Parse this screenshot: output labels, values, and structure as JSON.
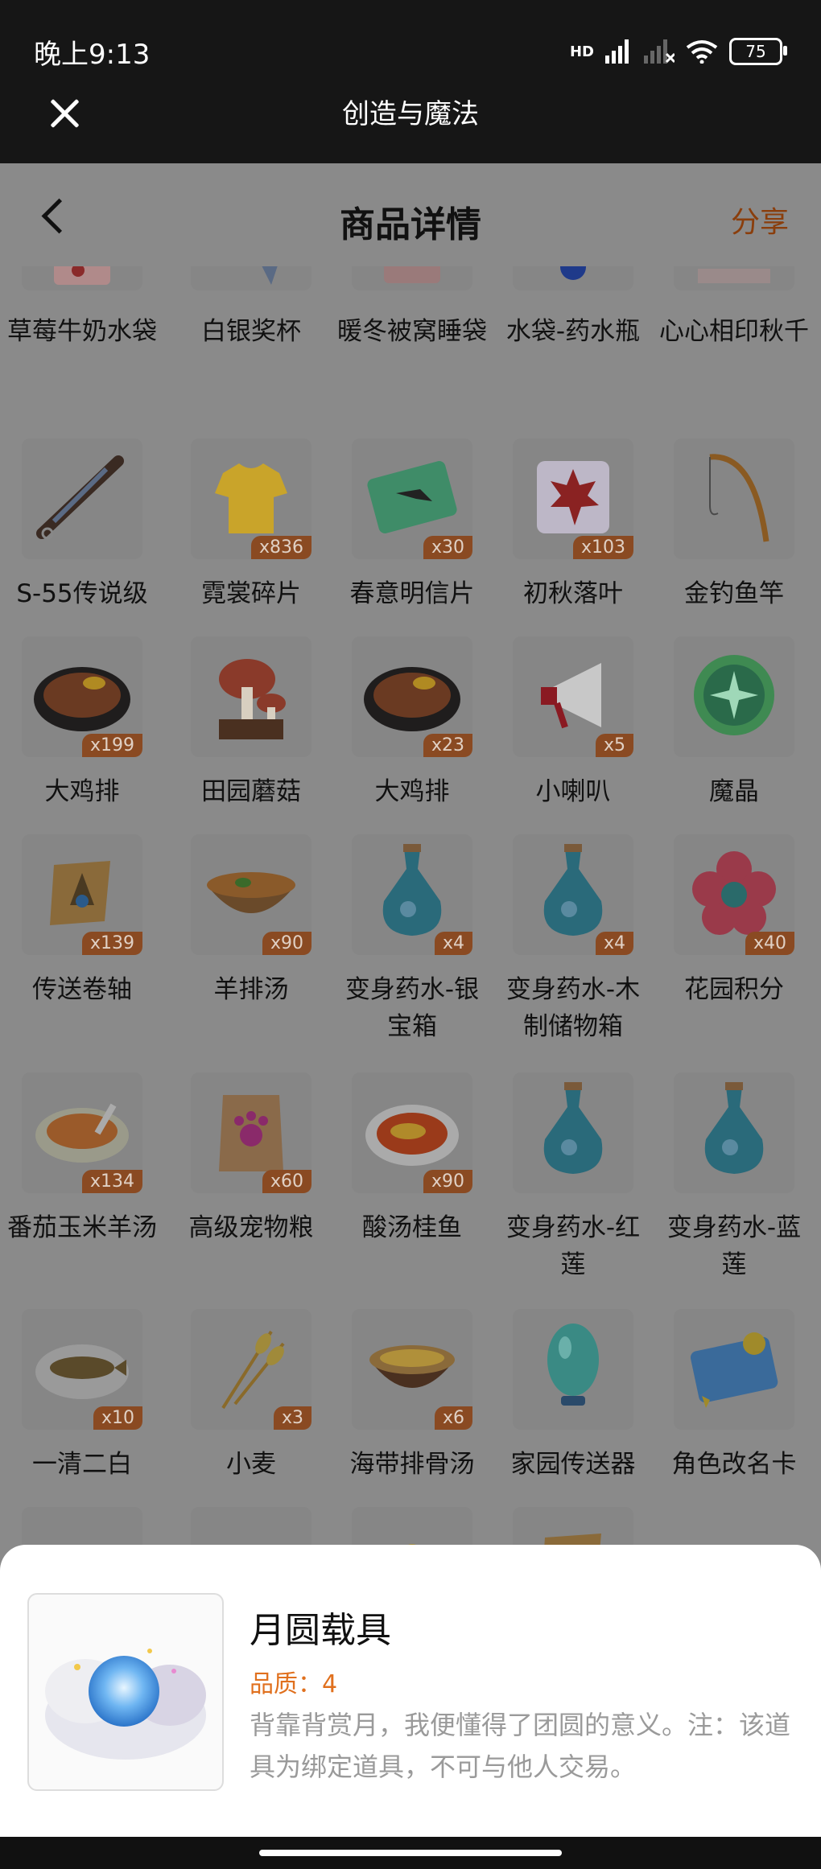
{
  "status_bar": {
    "time": "晚上9:13",
    "network": "HD",
    "battery": "75"
  },
  "app_bar": {
    "title": "创造与魔法"
  },
  "page": {
    "title": "商品详情",
    "share_label": "分享"
  },
  "items_partial_top": [
    {
      "name": "草莓牛奶水袋",
      "icon": "strawberry-milk-bag-icon"
    },
    {
      "name": "白银奖杯",
      "icon": "silver-trophy-icon"
    },
    {
      "name": "暖冬被窝睡袋",
      "icon": "sleeping-bag-icon"
    },
    {
      "name": "水袋-药水瓶",
      "icon": "potion-bottle-icon"
    },
    {
      "name": "心心相印秋千",
      "icon": "swing-icon"
    }
  ],
  "items": [
    {
      "name": "S-55传说级",
      "badge": "",
      "icon": "rifle-icon"
    },
    {
      "name": "霓裳碎片",
      "badge": "x836",
      "icon": "shirt-icon"
    },
    {
      "name": "春意明信片",
      "badge": "x30",
      "icon": "postcard-icon"
    },
    {
      "name": "初秋落叶",
      "badge": "x103",
      "icon": "maple-leaf-icon"
    },
    {
      "name": "金钓鱼竿",
      "badge": "",
      "icon": "fishing-rod-icon"
    },
    {
      "name": "大鸡排",
      "badge": "x199",
      "icon": "chicken-cutlet-icon"
    },
    {
      "name": "田园蘑菇",
      "badge": "",
      "icon": "mushroom-icon"
    },
    {
      "name": "大鸡排",
      "badge": "x23",
      "icon": "chicken-cutlet-icon"
    },
    {
      "name": "小喇叭",
      "badge": "x5",
      "icon": "megaphone-icon"
    },
    {
      "name": "魔晶",
      "badge": "",
      "icon": "magic-crystal-icon"
    },
    {
      "name": "传送卷轴",
      "badge": "x139",
      "icon": "scroll-icon"
    },
    {
      "name": "羊排汤",
      "badge": "x90",
      "icon": "soup-bowl-icon"
    },
    {
      "name": "变身药水-银宝箱",
      "badge": "x4",
      "icon": "potion-icon"
    },
    {
      "name": "变身药水-木制储物箱",
      "badge": "x4",
      "icon": "potion-icon"
    },
    {
      "name": "花园积分",
      "badge": "x40",
      "icon": "flower-icon"
    },
    {
      "name": "番茄玉米羊汤",
      "badge": "x134",
      "icon": "soup-plate-icon"
    },
    {
      "name": "高级宠物粮",
      "badge": "x60",
      "icon": "pet-food-bag-icon"
    },
    {
      "name": "酸汤桂鱼",
      "badge": "x90",
      "icon": "fish-dish-icon"
    },
    {
      "name": "变身药水-红莲",
      "badge": "",
      "icon": "potion-icon"
    },
    {
      "name": "变身药水-蓝莲",
      "badge": "",
      "icon": "potion-icon"
    },
    {
      "name": "一清二白",
      "badge": "x10",
      "icon": "fish-plate-icon"
    },
    {
      "name": "小麦",
      "badge": "x3",
      "icon": "wheat-icon"
    },
    {
      "name": "海带排骨汤",
      "badge": "x6",
      "icon": "soup-pot-icon"
    },
    {
      "name": "家园传送器",
      "badge": "",
      "icon": "teleporter-egg-icon"
    },
    {
      "name": "角色改名卡",
      "badge": "",
      "icon": "rename-card-icon"
    }
  ],
  "items_partial_bottom": [
    {
      "icon": "cloud-icon"
    },
    {
      "icon": "egg-icon"
    },
    {
      "icon": "gift-bag-icon"
    },
    {
      "icon": "scroll-icon"
    }
  ],
  "detail": {
    "name": "月圆载具",
    "quality": "品质：4",
    "description": "背靠背赏月，我便懂得了团圆的意义。注：该道具为绑定道具，不可与他人交易。",
    "icon": "moon-vehicle-icon"
  },
  "colors": {
    "accent": "#e0701e",
    "badge": "#8a4a22",
    "overlay": "#8a8a8a"
  }
}
